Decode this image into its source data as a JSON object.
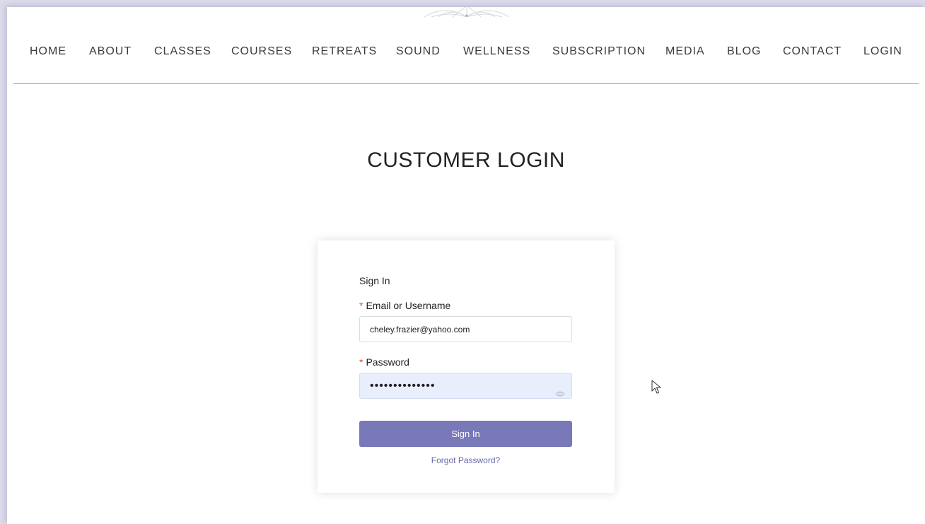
{
  "nav": {
    "items": [
      {
        "label": "HOME"
      },
      {
        "label": "ABOUT"
      },
      {
        "label": "CLASSES"
      },
      {
        "label": "COURSES"
      },
      {
        "label": "RETREATS"
      },
      {
        "label": "SOUND"
      },
      {
        "label": "WELLNESS"
      },
      {
        "label": "SUBSCRIPTION"
      },
      {
        "label": "MEDIA"
      },
      {
        "label": "BLOG"
      },
      {
        "label": "CONTACT"
      },
      {
        "label": "LOGIN"
      }
    ]
  },
  "page": {
    "title": "CUSTOMER LOGIN"
  },
  "login_form": {
    "heading": "Sign In",
    "required_marker": "*",
    "email_label": "Email or Username",
    "email_value": "cheley.frazier@yahoo.com",
    "password_label": "Password",
    "password_value": "••••••••••••••",
    "submit_label": "Sign In",
    "forgot_label": "Forgot Password?"
  },
  "colors": {
    "accent": "#7978b8",
    "link": "#6a69a8",
    "required": "#e0572f",
    "autofill": "#e8eefc"
  },
  "icons": {
    "password_toggle": "eye-icon",
    "pointer": "mouse-cursor-icon",
    "logo": "mandala-logo-icon"
  }
}
